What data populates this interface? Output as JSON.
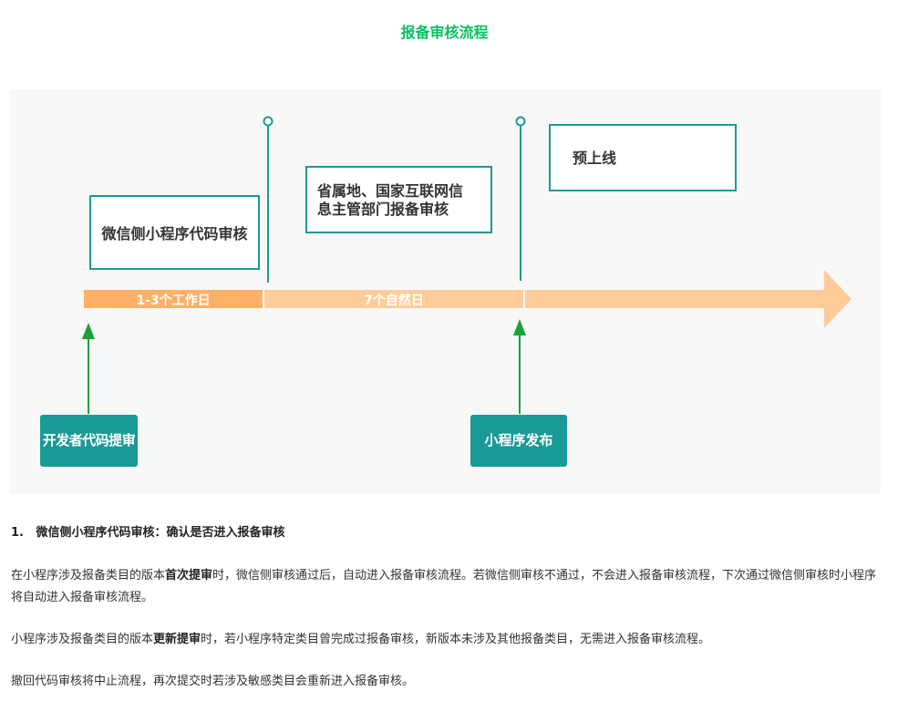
{
  "title": "报备审核流程",
  "diagram": {
    "box_wechat": "微信侧小程序代码审核",
    "box_gov_line1": "省属地、国家互联网信",
    "box_gov_line2": "息主管部门报备审核",
    "box_prelaunch": "预上线",
    "segment_1": "1-3个工作日",
    "segment_2": "7个自然日",
    "tag_dev": "开发者代码提审",
    "tag_release": "小程序发布",
    "colors": {
      "teal": "#1a9a96",
      "green_arrow": "#1aa13a",
      "bar_dark": "#ffb066",
      "bar_light": "#ffcc99",
      "title": "#07c160"
    }
  },
  "section": {
    "heading": "1.   微信侧小程序代码审核：确认是否进入报备审核",
    "p1": {
      "a": "在小程序涉及报备类目的版本",
      "b": "首次提审",
      "c": "时，微信侧审核通过后，自动进入报备审核流程。若微信侧审核不通过，不会进入报备审核流程，下次通过微信侧审核时小程序将自动进入报备审核流程。"
    },
    "p2": {
      "a": "小程序涉及报备类目的版本",
      "b": "更新提审",
      "c": "时，若小程序特定类目曾完成过报备审核，新版本未涉及其他报备类目，无需进入报备审核流程。"
    },
    "p3": "撤回代码审核将中止流程，再次提交时若涉及敏感类目会重新进入报备审核。"
  }
}
